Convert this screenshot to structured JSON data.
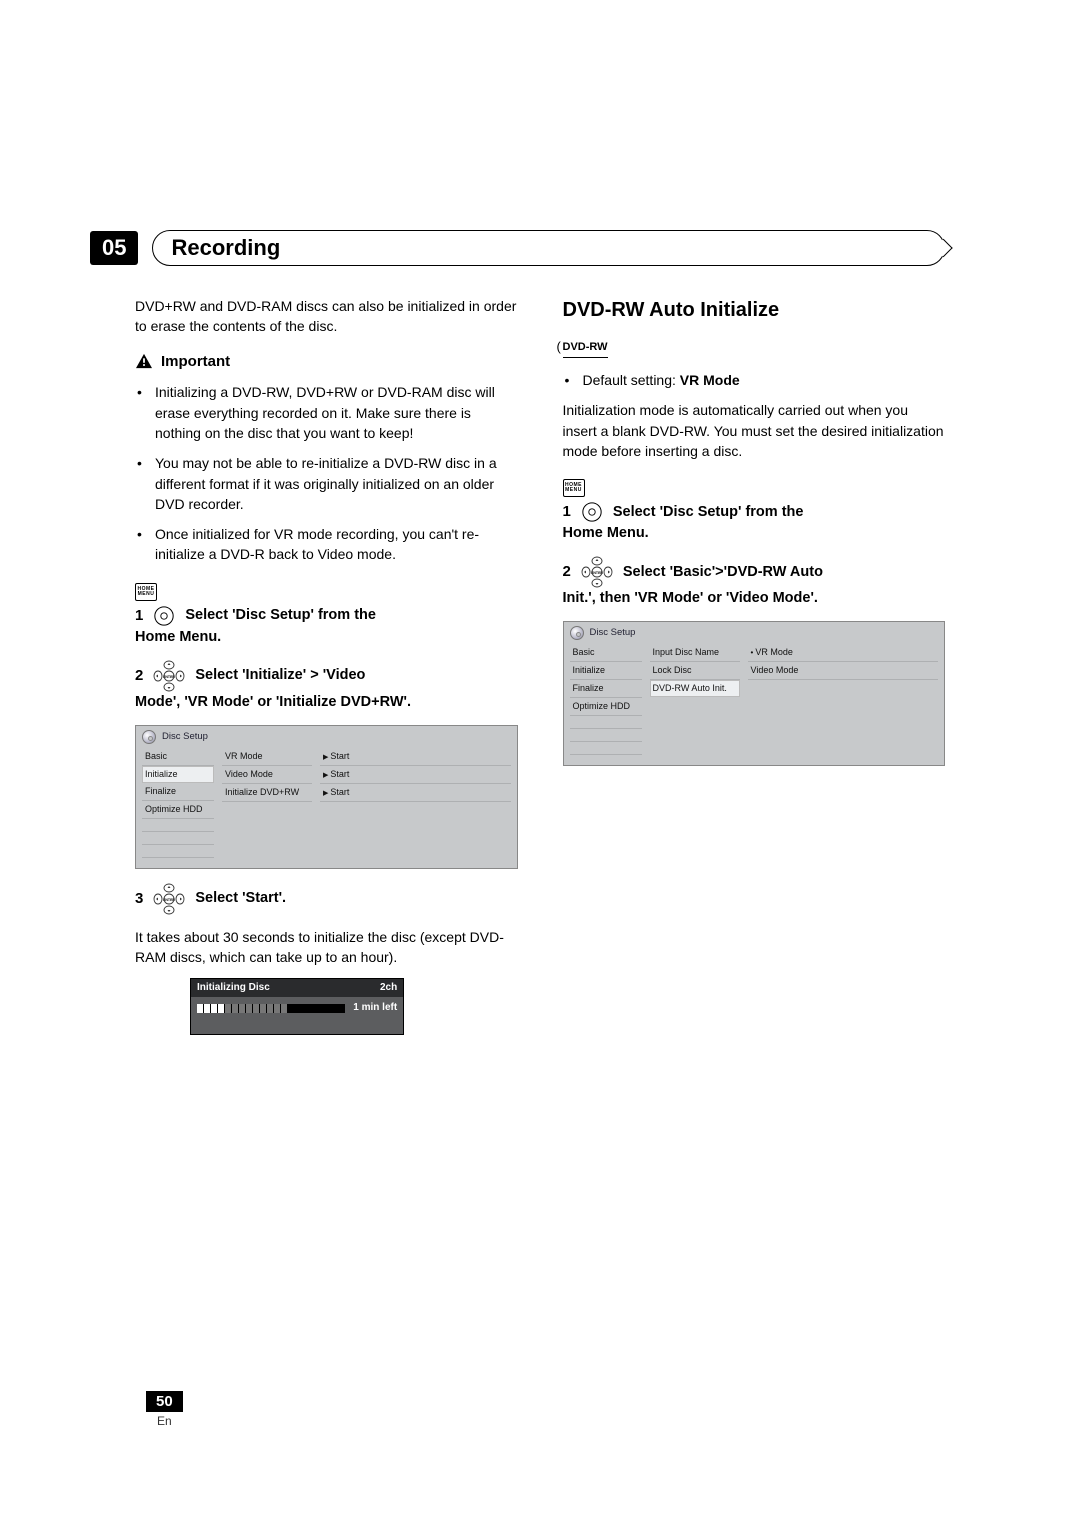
{
  "chapter": {
    "number": "05",
    "title": "Recording"
  },
  "left": {
    "intro": "DVD+RW and DVD-RAM discs can also be initialized in order to erase the contents of the disc.",
    "important_label": "Important",
    "important_items": [
      "Initializing a DVD-RW, DVD+RW or DVD-RAM disc will erase everything recorded on it. Make sure there is nothing on the disc that you want to keep!",
      "You may not be able to re-initialize a DVD-RW disc in a different format if it was originally initialized on an older DVD recorder.",
      "Once initialized for VR mode recording, you can't re-initialize a DVD-R back to Video mode."
    ],
    "home_icon_line1": "HOME",
    "home_icon_line2": "MENU",
    "step1a": "Select 'Disc Setup' from the",
    "step1b": "Home Menu.",
    "step2a": "Select 'Initialize' > 'Video",
    "step2b": "Mode', 'VR Mode' or 'Initialize DVD+RW'.",
    "osd1": {
      "title": "Disc Setup",
      "col1": [
        "Basic",
        "Initialize",
        "Finalize",
        "Optimize HDD"
      ],
      "col1_sel": 1,
      "col2": [
        "VR Mode",
        "Video Mode",
        "Initialize DVD+RW"
      ],
      "col3": [
        "Start",
        "Start",
        "Start"
      ]
    },
    "step3": "Select 'Start'.",
    "step3_follow": "It takes about 30 seconds to initialize the disc (except DVD-RAM discs, which can take up to an hour).",
    "progress": {
      "title": "Initializing Disc",
      "ch": "2ch",
      "time": "1 min left"
    }
  },
  "right": {
    "heading": "DVD-RW Auto Initialize",
    "disc_label": "DVD-RW",
    "default_prefix": "Default setting: ",
    "default_value": "VR Mode",
    "para": "Initialization mode is automatically carried out when you insert a blank DVD-RW. You must set the desired initialization mode before inserting a disc.",
    "step1a": "Select 'Disc Setup' from the",
    "step1b": "Home Menu.",
    "step2a": "Select 'Basic'>'DVD-RW Auto",
    "step2b": "Init.', then 'VR Mode' or 'Video Mode'.",
    "osd2": {
      "title": "Disc Setup",
      "col1": [
        "Basic",
        "Initialize",
        "Finalize",
        "Optimize HDD"
      ],
      "col1_sel": 0,
      "col2": [
        "Input Disc Name",
        "Lock Disc",
        "DVD-RW Auto Init."
      ],
      "col2_sel": 2,
      "col3": [
        "VR Mode",
        "Video Mode"
      ]
    }
  },
  "footer": {
    "page": "50",
    "lang": "En"
  }
}
